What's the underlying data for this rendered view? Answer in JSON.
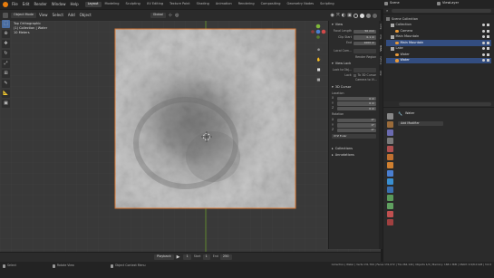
{
  "topbar": {
    "menus": [
      "File",
      "Edit",
      "Render",
      "Window",
      "Help"
    ],
    "workspaces": [
      "Layout",
      "Modeling",
      "Sculpting",
      "UV Editing",
      "Texture Paint",
      "Shading",
      "Animation",
      "Rendering",
      "Compositing",
      "Geometry Nodes",
      "Scripting"
    ],
    "active_workspace": "Layout",
    "scene": "Scene",
    "view_layer": "ViewLayer"
  },
  "viewport_header": {
    "mode": "Object Mode",
    "menus": [
      "View",
      "Select",
      "Add",
      "Object"
    ],
    "transform_orientation": "Global"
  },
  "viewport_info": {
    "line1": "Top Orthographic",
    "line2": "(1) Collection | Water",
    "line3": "10 Meters"
  },
  "npanel": {
    "view_section": "View",
    "focal_length_label": "Focal Length",
    "focal_length_value": "50 mm",
    "clip_start_label": "Clip Start",
    "clip_start_value": "0.1 m",
    "clip_end_label": "End",
    "clip_end_value": "1000 m",
    "local_camera_label": "Local Cam...",
    "render_region_label": "Render Region",
    "view_lock_section": "View Lock",
    "lock_to_object_label": "Lock to Obj...",
    "lock_label": "Lock",
    "to_3d_cursor_label": "To 3D Cursor",
    "camera_to_view_label": "Camera to Vi...",
    "cursor_section": "3D Cursor",
    "location_label": "Location",
    "loc_x_label": "X",
    "loc_x_value": "0 m",
    "loc_y_label": "Y",
    "loc_y_value": "0 m",
    "loc_z_label": "Z",
    "loc_z_value": "0 m",
    "rotation_label": "Rotation",
    "rot_x_label": "X",
    "rot_x_value": "0°",
    "rot_y_label": "Y",
    "rot_y_value": "0°",
    "rot_z_label": "Z",
    "rot_z_value": "0°",
    "rotation_mode": "XYZ Euler",
    "collections_section": "Collections",
    "annotations_section": "Annotations",
    "tabs": [
      "Item",
      "Tool",
      "View",
      "Create",
      "Edit"
    ]
  },
  "outliner": {
    "root": "Scene Collection",
    "rows": [
      {
        "label": "Collection",
        "indent": 1,
        "selected": false
      },
      {
        "label": "Camera",
        "indent": 2,
        "selected": false
      },
      {
        "label": "Main Mountain",
        "indent": 1,
        "selected": false
      },
      {
        "label": "Main Mountain",
        "indent": 2,
        "selected": true
      },
      {
        "label": "Lake",
        "indent": 1,
        "selected": false
      },
      {
        "label": "Water",
        "indent": 2,
        "selected": false
      },
      {
        "label": "Water",
        "indent": 2,
        "selected": true
      }
    ]
  },
  "properties": {
    "object_name": "Water",
    "add_modifier": "Add Modifier"
  },
  "timeline": {
    "playback": "Playback",
    "current_frame": "1",
    "start_label": "Start",
    "start": "1",
    "end_label": "End",
    "end": "250"
  },
  "statusbar": {
    "select": "Select",
    "rotate_view": "Rotate View",
    "context_menu": "Object Context Menu",
    "stats": "Collection | Water | Verts 131,769 | Faces 131,072 | Tris 262,144 | Objects 1/4 | Memory: 168.1 MiB | VRAM: 0.9/8.0 GiB | 3.0.0"
  },
  "colors": {
    "accent": "#4a6da0",
    "selection_outline": "#e8823a",
    "x_axis": "#a33b3b",
    "y_axis": "#6b9a2e"
  }
}
